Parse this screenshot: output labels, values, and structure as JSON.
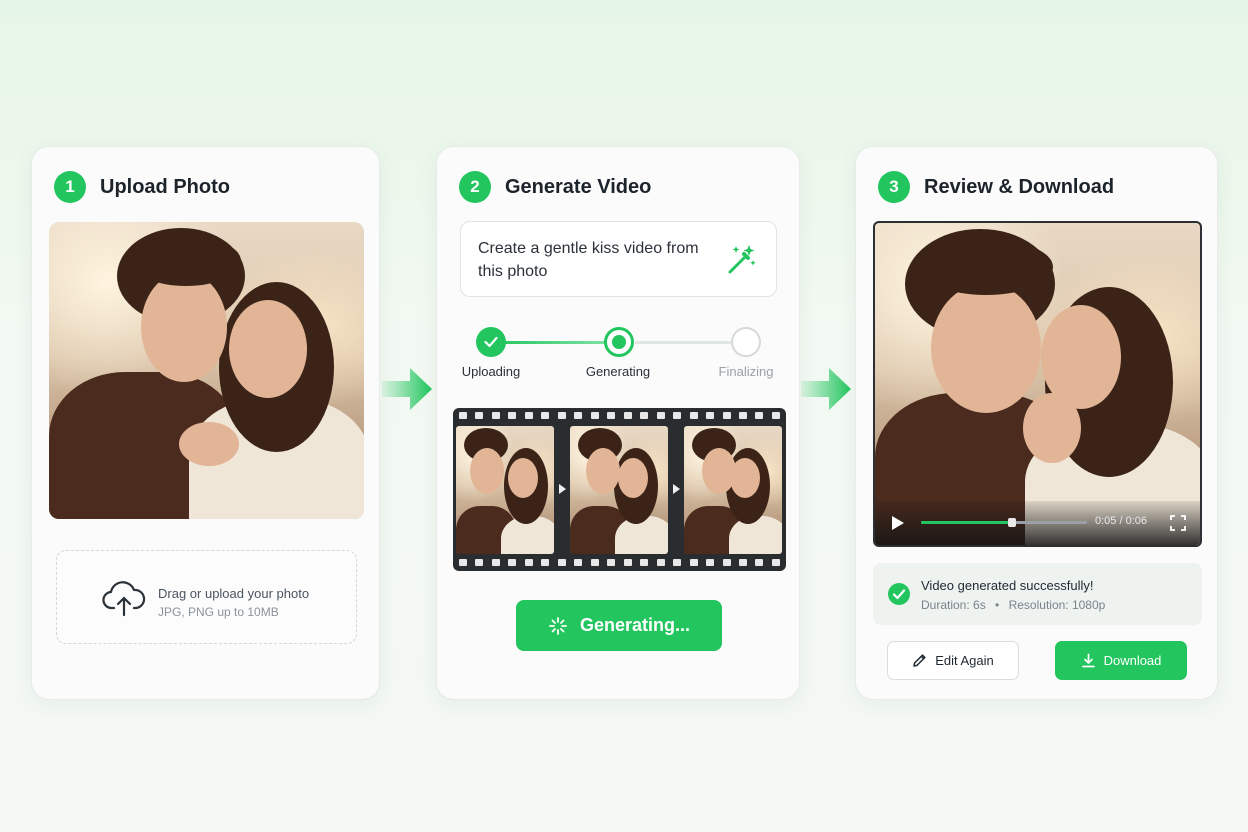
{
  "steps": [
    {
      "number": "1",
      "title": "Upload Photo"
    },
    {
      "number": "2",
      "title": "Generate Video"
    },
    {
      "number": "3",
      "title": "Review & Download"
    }
  ],
  "upload": {
    "primary_text": "Drag or upload your photo",
    "secondary_text": "JPG, PNG up to 10MB"
  },
  "prompt": {
    "text": "Create a gentle kiss video from this photo"
  },
  "progress": {
    "stages": [
      {
        "label": "Uploading",
        "state": "done"
      },
      {
        "label": "Generating",
        "state": "active"
      },
      {
        "label": "Finalizing",
        "state": "pending"
      }
    ]
  },
  "generate_button": {
    "label": "Generating..."
  },
  "video_player": {
    "time": "0:05 / 0:06",
    "progress_fraction": 0.55
  },
  "result": {
    "status": "Video generated successfully!",
    "duration": "Duration: 6s",
    "separator": "•",
    "resolution": "Resolution: 1080p"
  },
  "actions": {
    "edit_label": "Edit Again",
    "download_label": "Download"
  },
  "colors": {
    "accent": "#22c55e",
    "background": "#eef7ee"
  },
  "icons": [
    "upload-cloud-icon",
    "magic-wand-icon",
    "check-icon",
    "sparkle-icon",
    "play-icon",
    "fullscreen-icon",
    "pencil-icon",
    "download-icon",
    "flow-arrow-icon"
  ]
}
